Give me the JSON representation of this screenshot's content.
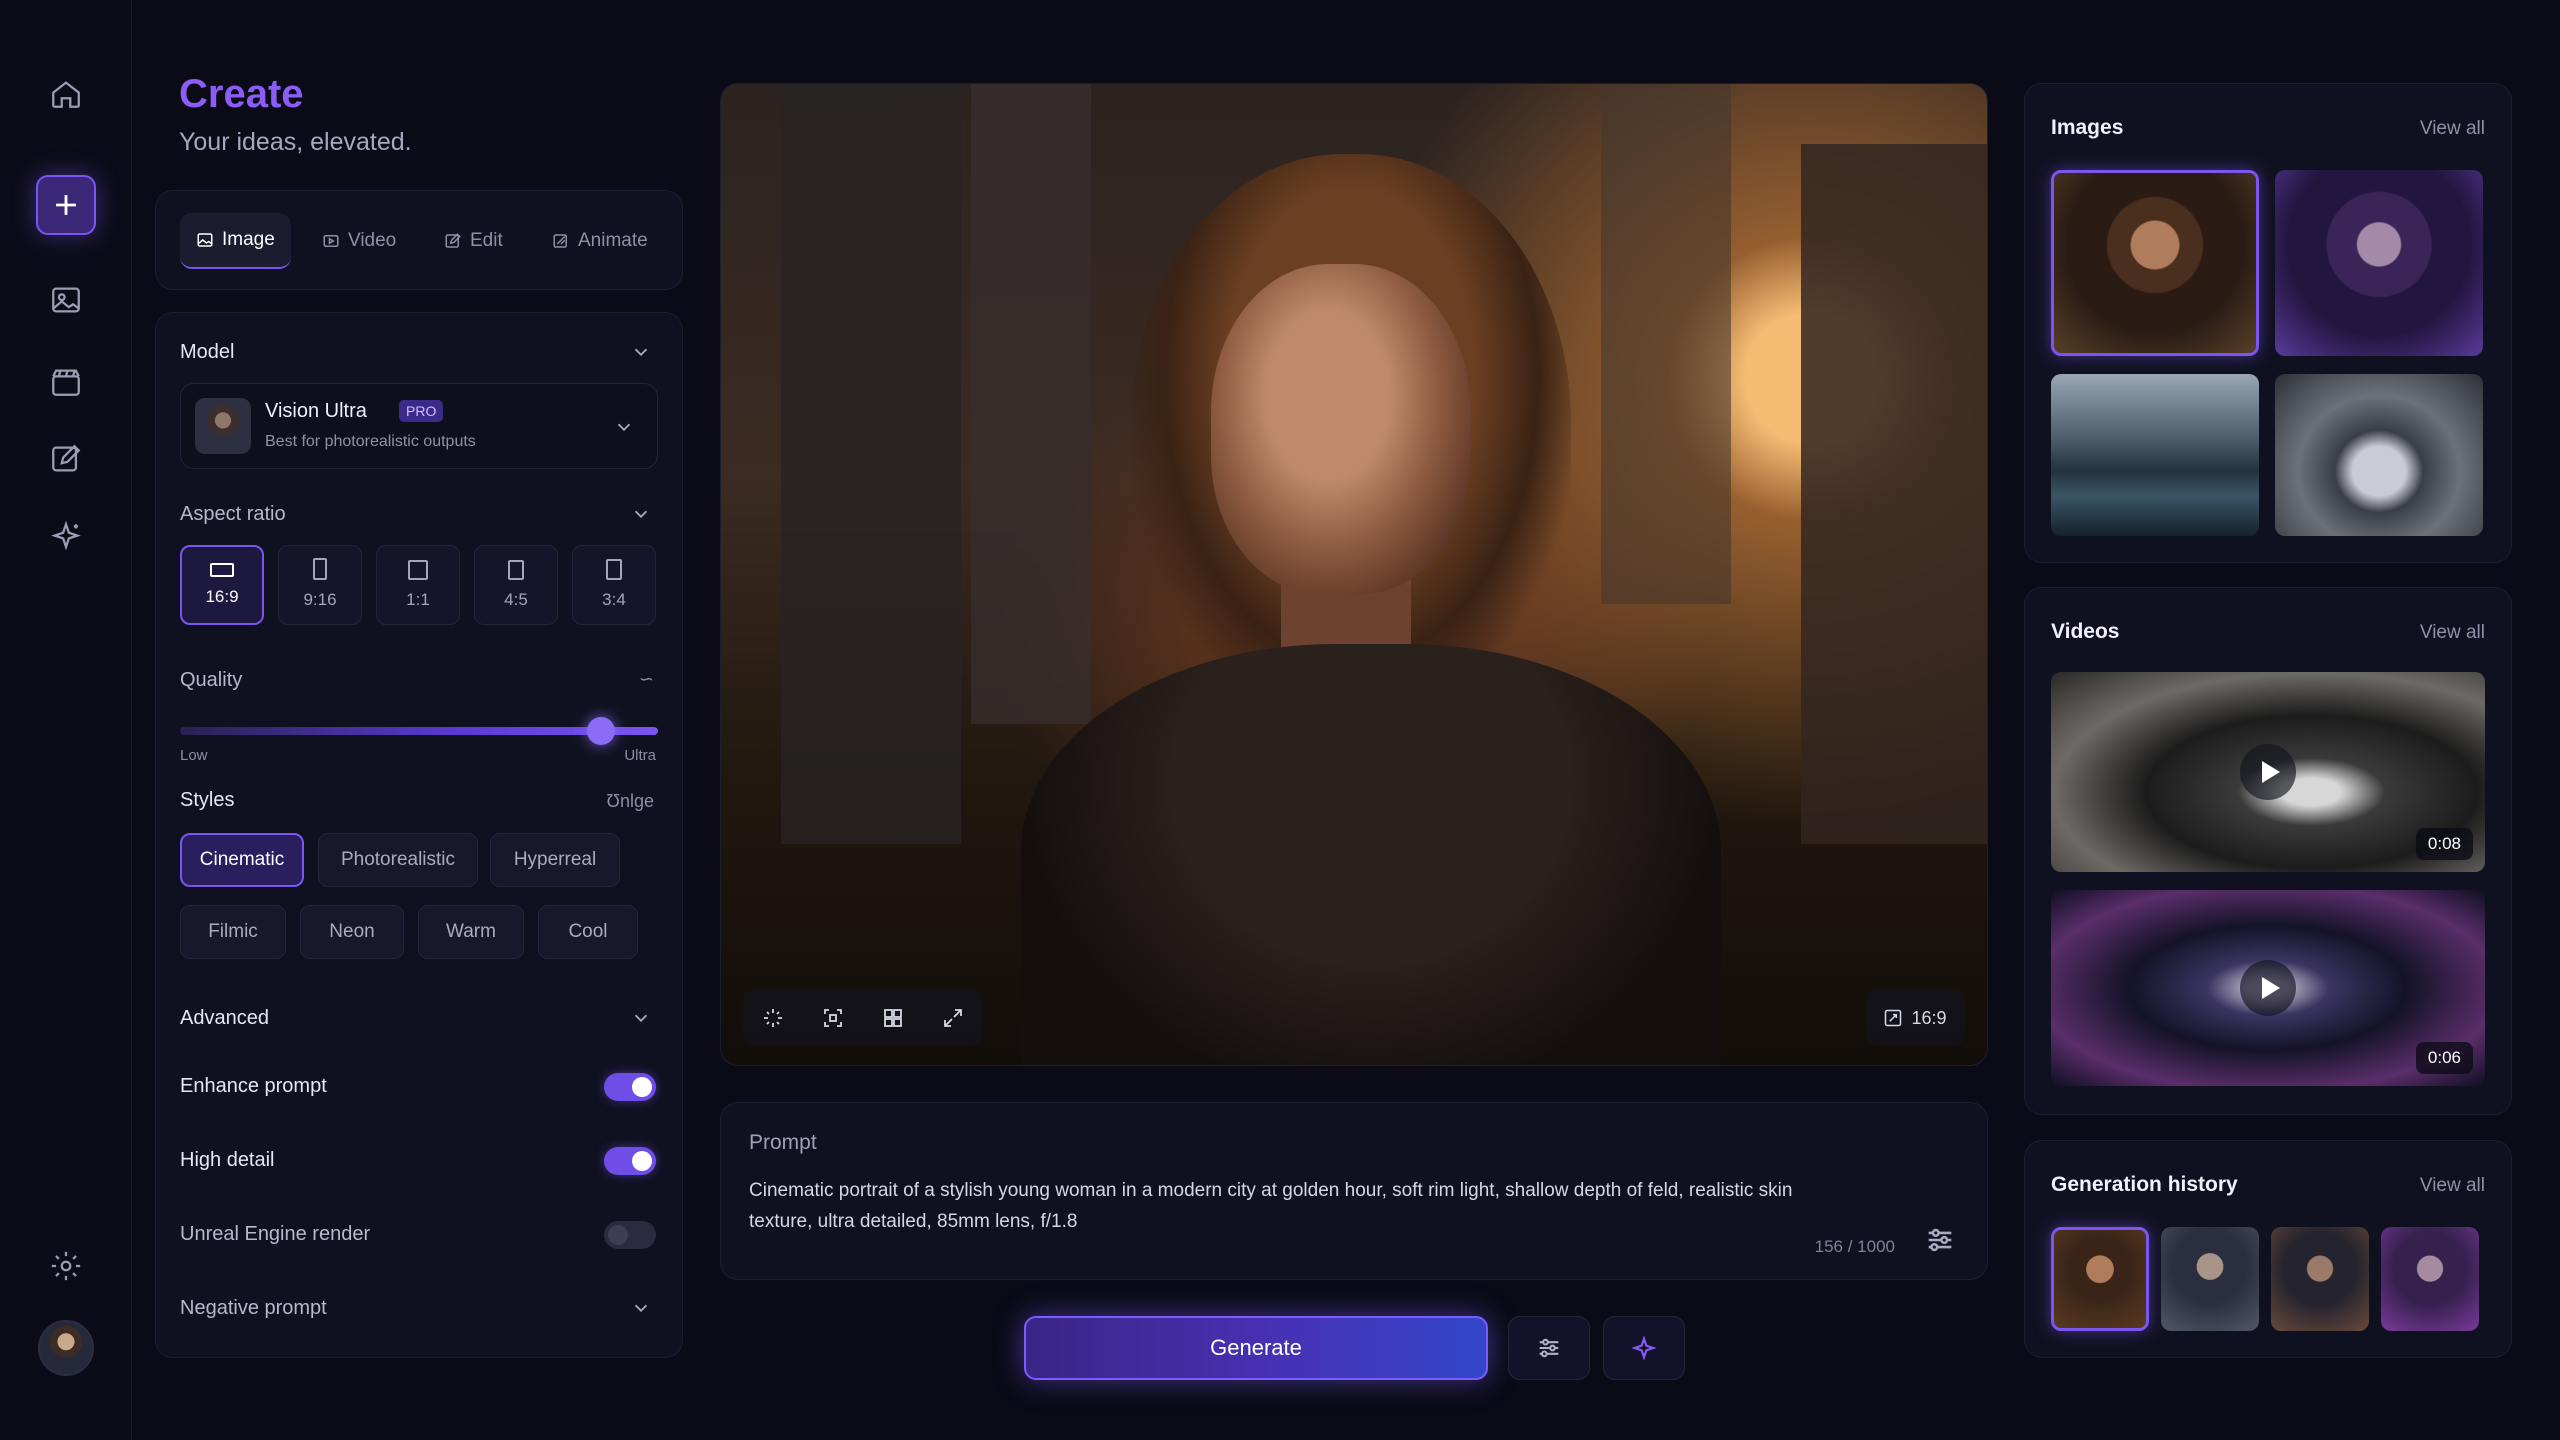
{
  "sidebar": {
    "icons": [
      "home-icon",
      "plus-icon",
      "image-icon",
      "clapperboard-icon",
      "edit-icon",
      "sparkle-icon",
      "settings-icon"
    ]
  },
  "header": {
    "title": "Create",
    "subtitle": "Your ideas, elevated."
  },
  "tabs": [
    {
      "label": "Image",
      "icon": "image-icon",
      "active": true
    },
    {
      "label": "Video",
      "icon": "video-icon",
      "active": false
    },
    {
      "label": "Edit",
      "icon": "edit-icon",
      "active": false
    },
    {
      "label": "Animate",
      "icon": "animate-icon",
      "active": false
    }
  ],
  "model": {
    "label": "Model",
    "name": "Vision Ultra",
    "badge": "PRO",
    "description": "Best for photorealistic outputs"
  },
  "aspect_ratio": {
    "label": "Aspect ratio",
    "options": [
      "16:9",
      "9:16",
      "1:1",
      "4:5",
      "3:4"
    ],
    "selected": "16:9"
  },
  "quality": {
    "label": "Quality",
    "min_label": "Low",
    "max_label": "Ultra",
    "level": 0.88,
    "corner_glyph": "∽"
  },
  "styles": {
    "label": "Styles",
    "corner_text": "Ʊnlge",
    "chips": [
      "Cinematic",
      "Photorealistic",
      "Hyperreal",
      "Filmic",
      "Neon",
      "Warm",
      "Cool"
    ],
    "selected": "Cinematic"
  },
  "advanced": {
    "label": "Advanced",
    "toggles": [
      {
        "label": "Enhance prompt",
        "on": true
      },
      {
        "label": "High detail",
        "on": true
      },
      {
        "label": "Unreal Engine render",
        "on": false
      }
    ],
    "negative_prompt_label": "Negative prompt"
  },
  "preview": {
    "ratio_badge": "16:9"
  },
  "prompt": {
    "label": "Prompt",
    "text": "Cinematic portrait of a stylish young woman in a modern city at golden hour, soft rim light, shallow depth of feld, realistic skin texture, ultra detailed, 85mm lens, f/1.8",
    "count": "156 / 1000"
  },
  "actions": {
    "generate_label": "Generate"
  },
  "right_panel": {
    "images": {
      "title": "Images",
      "view_all": "View all"
    },
    "videos": {
      "title": "Videos",
      "view_all": "View all",
      "durations": [
        "0:08",
        "0:06"
      ]
    },
    "history": {
      "title": "Generation history",
      "view_all": "View all"
    }
  },
  "colors": {
    "accent": "#7a55f0",
    "title": "#8b5cf6",
    "background": "#0a0b16"
  }
}
